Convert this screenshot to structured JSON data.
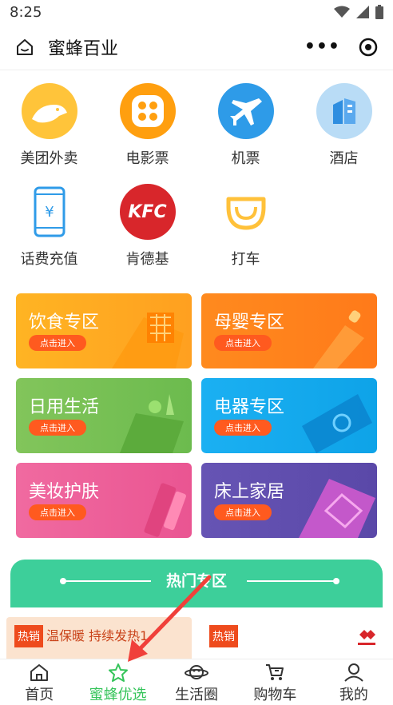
{
  "status_bar": {
    "time": "8:25"
  },
  "nav": {
    "title": "蜜蜂百业",
    "more": "•••"
  },
  "shortcuts": [
    {
      "label": "美团外卖",
      "icon": "meituan-icon",
      "color": "#ffc43a"
    },
    {
      "label": "电影票",
      "icon": "film-reel-icon",
      "color": "#ff9f0f"
    },
    {
      "label": "机票",
      "icon": "airplane-icon",
      "color": "#2e9be8"
    },
    {
      "label": "酒店",
      "icon": "hotel-building-icon",
      "color": "#b9dcf6"
    },
    {
      "label": "话费充值",
      "icon": "phone-recharge-icon",
      "color": "#2f9be8"
    },
    {
      "label": "肯德基",
      "icon": "kfc-icon",
      "color": "#d8262b"
    },
    {
      "label": "打车",
      "icon": "taxi-icon",
      "color": "#ffc13a"
    }
  ],
  "kfc_text": "KFC",
  "categories": [
    {
      "title": "饮食专区",
      "button": "点击进入",
      "color": "#ffb020"
    },
    {
      "title": "母婴专区",
      "button": "点击进入",
      "color": "#ff8a20"
    },
    {
      "title": "日用生活",
      "button": "点击进入",
      "color": "#7cc25a"
    },
    {
      "title": "电器专区",
      "button": "点击进入",
      "color": "#19aef0"
    },
    {
      "title": "美妆护肤",
      "button": "点击进入",
      "color": "#f0609a"
    },
    {
      "title": "床上家居",
      "button": "点击进入",
      "color": "#6252b0"
    }
  ],
  "hot_zone": {
    "title": "热门专区"
  },
  "products": [
    {
      "tag": "热销",
      "text": "温保暖 持续发热1"
    },
    {
      "tag": "热销"
    }
  ],
  "tabs": [
    {
      "label": "首页",
      "icon": "home-icon"
    },
    {
      "label": "蜜蜂优选",
      "icon": "star-icon",
      "active": true
    },
    {
      "label": "生活圈",
      "icon": "planet-icon"
    },
    {
      "label": "购物车",
      "icon": "cart-icon"
    },
    {
      "label": "我的",
      "icon": "user-icon"
    }
  ],
  "colors": {
    "accent_green": "#35c45a",
    "hot_green": "#3dcf9a",
    "annotation_red": "#f0403a"
  }
}
